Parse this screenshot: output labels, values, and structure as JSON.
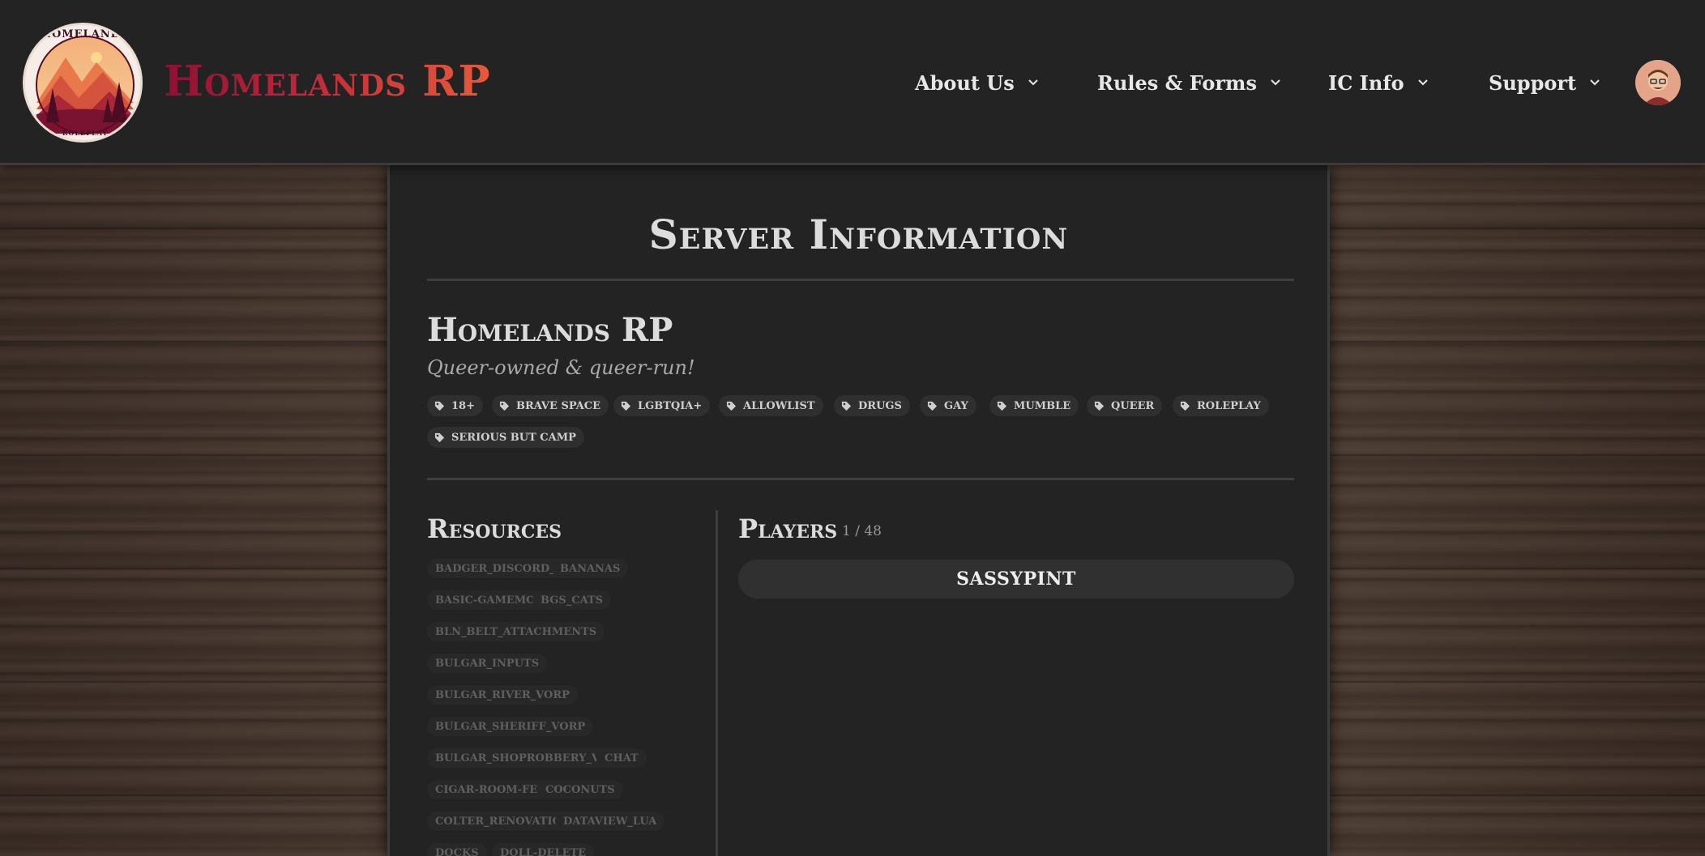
{
  "header": {
    "brand": "Homelands RP",
    "logo": {
      "top_text": "HOMELANDS",
      "bottom_text": "ROLEPLAY"
    },
    "nav": [
      {
        "label": "About Us",
        "icon": "chevron-down-icon"
      },
      {
        "label": "Rules & Forms",
        "icon": "chevron-down-icon"
      },
      {
        "label": "IC Info",
        "icon": "chevron-down-icon"
      },
      {
        "label": "Support",
        "icon": "chevron-down-icon"
      }
    ],
    "avatar_icon": "user-avatar"
  },
  "main": {
    "title": "Server Information",
    "server_name": "Homelands RP",
    "server_desc": "Queer-owned & queer-run!",
    "tags": [
      "18+",
      "BRAVE SPACE",
      "LGBTQIA+",
      "ALLOWLIST",
      "DRUGS",
      "GAY",
      "MUMBLE",
      "QUEER",
      "ROLEPLAY",
      "SERIOUS BUT CAMP"
    ],
    "tag_icon": "tag-icon",
    "resources_title": "Resources",
    "resources": [
      "BADGER_DISCORD_API",
      "BANANAS",
      "BASIC-GAMEMODE",
      "BGS_CATS",
      "BLN_BELT_ATTACHMENTS",
      "BULGAR_INPUTS",
      "BULGAR_RIVER_VORP",
      "BULGAR_SHERIFF_VORP",
      "BULGAR_SHOPROBBERY_VORP",
      "CHAT",
      "CIGAR-ROOM-FEM",
      "COCONUTS",
      "COLTER_RENOVATION",
      "DATAVIEW_LUA",
      "DOCKS",
      "DOLL-DELETE"
    ],
    "players_title": "Players",
    "players_count": "1 / 48",
    "players": [
      "SASSYPINT"
    ]
  },
  "colors": {
    "bar": "#232323",
    "panel": "#232323",
    "brand_start": "#8e1033",
    "brand_end": "#e85a3a",
    "chip": "#2f2f2f"
  }
}
